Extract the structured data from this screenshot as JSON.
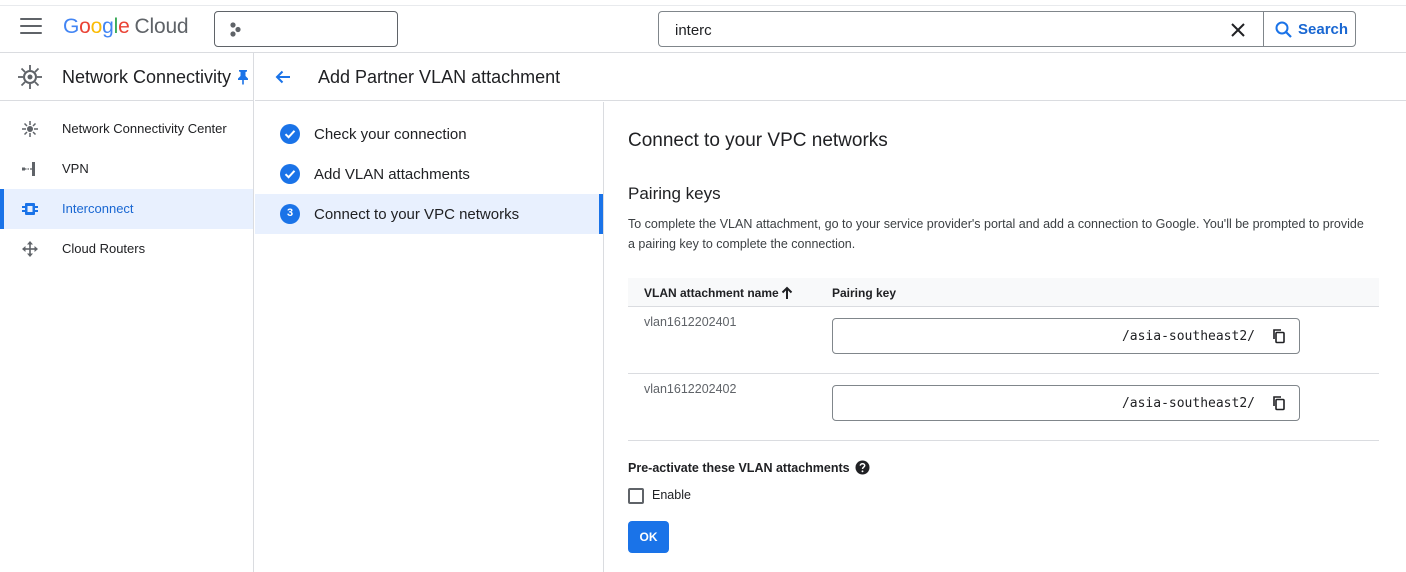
{
  "topbar": {
    "logo": {
      "letters": [
        "G",
        "o",
        "o",
        "g",
        "l",
        "e"
      ],
      "product": "Cloud"
    },
    "search": {
      "value": "interc",
      "button_label": "Search"
    }
  },
  "sidebar": {
    "title": "Network Connectivity",
    "items": [
      {
        "label": "Network Connectivity Center",
        "icon": "hub-icon",
        "active": false
      },
      {
        "label": "VPN",
        "icon": "vpn-icon",
        "active": false
      },
      {
        "label": "Interconnect",
        "icon": "interconnect-icon",
        "active": true
      },
      {
        "label": "Cloud Routers",
        "icon": "router-icon",
        "active": false
      }
    ]
  },
  "page": {
    "title": "Add Partner VLAN attachment"
  },
  "stepper": {
    "steps": [
      {
        "label": "Check your connection",
        "state": "done"
      },
      {
        "label": "Add VLAN attachments",
        "state": "done"
      },
      {
        "label": "Connect to your VPC networks",
        "state": "active",
        "number": "3"
      }
    ]
  },
  "main": {
    "heading": "Connect to your VPC networks",
    "subheading": "Pairing keys",
    "description": "To complete the VLAN attachment, go to your service provider's portal and add a connection to Google. You'll be prompted to provide a pairing key to complete the connection.",
    "table": {
      "col_name": "VLAN attachment name",
      "col_key": "Pairing key",
      "rows": [
        {
          "name": "vlan1612202401",
          "key": "/asia-southeast2/"
        },
        {
          "name": "vlan1612202402",
          "key": "/asia-southeast2/"
        }
      ]
    },
    "preactivate_label": "Pre-activate these VLAN attachments",
    "enable_label": "Enable",
    "ok_label": "OK"
  },
  "colors": {
    "accent": "#1a73e8",
    "active_bg": "#e8f0fe",
    "border": "#dadce0"
  }
}
